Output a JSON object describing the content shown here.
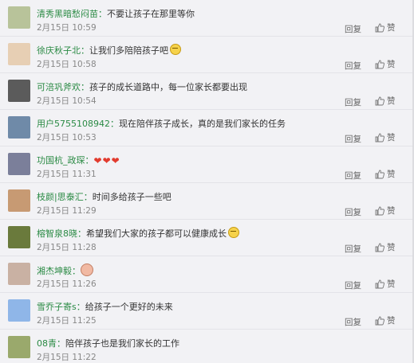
{
  "ui": {
    "reply_label": "回复",
    "like_label": "赞"
  },
  "comments": [
    {
      "name": "清秀黑暗愁闷苗：",
      "text": "不要让孩子在那里等你",
      "time": "2月15日 10:59",
      "emoji": "",
      "avatar_color": "#b8c39a"
    },
    {
      "name": "徐庆秋子北：",
      "text": "让我们多陪陪孩子吧",
      "time": "2月15日 10:58",
      "emoji": "face",
      "avatar_color": "#e7cfb4"
    },
    {
      "name": "可涪巩斧欢：",
      "text": "孩子的成长道路中，每一位家长都要出现",
      "time": "2月15日 10:54",
      "emoji": "",
      "avatar_color": "#5b5b5b"
    },
    {
      "name": "用户5755108942：",
      "text": "现在陪伴孩子成长，真的是我们家长的任务",
      "time": "2月15日 10:53",
      "emoji": "",
      "avatar_color": "#6f8aa8"
    },
    {
      "name": "功国杭_政琛：",
      "text": "",
      "time": "2月15日 11:31",
      "emoji": "hearts",
      "avatar_color": "#7b7f9a"
    },
    {
      "name": "枝颜|思泰汇：",
      "text": "时间多给孩子一些吧",
      "time": "2月15日 11:29",
      "emoji": "",
      "avatar_color": "#c79a73"
    },
    {
      "name": "榕智泉8晓：",
      "text": "希望我们大家的孩子都可以健康成长",
      "time": "2月15日 11:28",
      "emoji": "face",
      "avatar_color": "#6a7a3c"
    },
    {
      "name": "湘杰坤毅：",
      "text": "",
      "time": "2月15日 11:26",
      "emoji": "baby",
      "avatar_color": "#c9b1a3"
    },
    {
      "name": "雪乔子寄s：",
      "text": "给孩子一个更好的未来",
      "time": "2月15日 11:25",
      "emoji": "",
      "avatar_color": "#8fb6e8"
    },
    {
      "name": "08青：",
      "text": "陪伴孩子也是我们家长的工作",
      "time": "2月15日 11:22",
      "emoji": "",
      "avatar_color": "#9aa96c"
    }
  ]
}
